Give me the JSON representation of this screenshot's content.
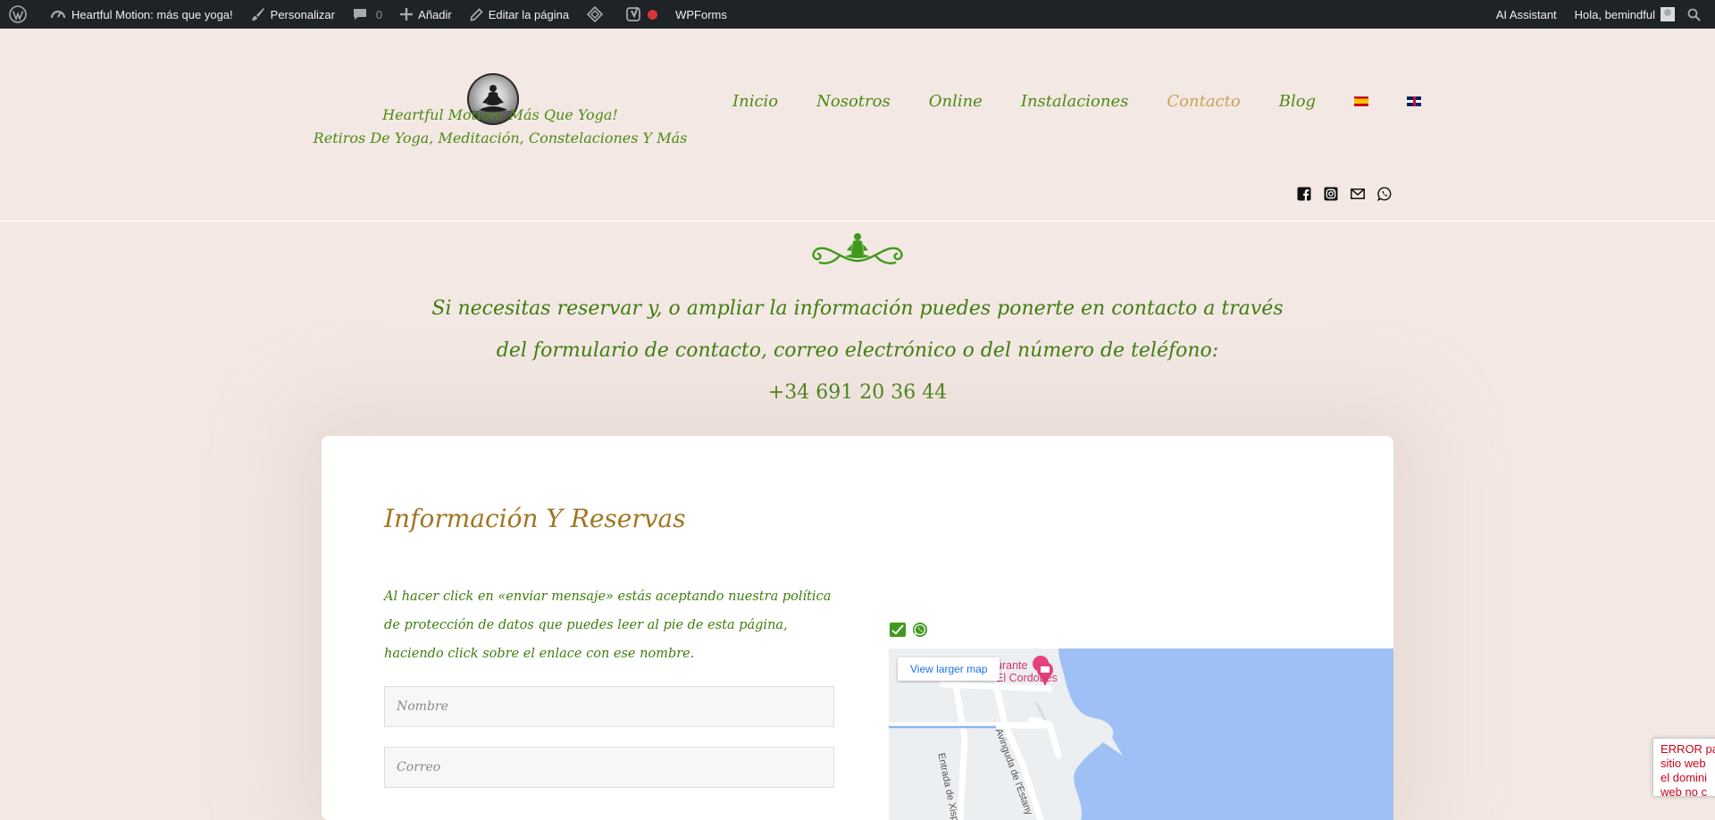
{
  "admin_bar": {
    "site_name": "Heartful Motion: más que yoga!",
    "customize": "Personalizar",
    "comments_count": "0",
    "add_new": "Añadir",
    "edit_page": "Editar la página",
    "wpforms": "WPForms",
    "ai_assistant": "AI Assistant",
    "greeting": "Hola, bemindful"
  },
  "header": {
    "site_title": "Heartful Motion: Más Que Yoga!",
    "tagline": "Retiros De Yoga, Meditación, Constelaciones Y Más"
  },
  "nav": {
    "items": [
      {
        "label": "Inicio"
      },
      {
        "label": "Nosotros"
      },
      {
        "label": "Online"
      },
      {
        "label": "Instalaciones"
      },
      {
        "label": "Contacto",
        "active": true
      },
      {
        "label": "Blog"
      }
    ],
    "languages": [
      "es",
      "en"
    ]
  },
  "social_icons": [
    "facebook-icon",
    "instagram-icon",
    "email-icon",
    "whatsapp-icon"
  ],
  "intro": {
    "line1": "Si necesitas reservar y, o ampliar la información puedes ponerte en contacto a través",
    "line2": "del formulario de contacto, correo electrónico o del número de teléfono:",
    "phone": "+34 691 20 36 44"
  },
  "form": {
    "title": "Información Y Reservas",
    "consent": "Al hacer click en «enviar mensaje» estás aceptando nuestra política de protección de datos que puedes leer al pie de esta página, haciendo click sobre el enlace con ese nombre.",
    "name_placeholder": "Nombre",
    "email_placeholder": "Correo"
  },
  "map": {
    "button": "View larger map",
    "poi_line1": "urante",
    "poi_line2": "El Cordobés",
    "street1": "Entrada de Xispa",
    "street2": "Avinguda de l'Estany"
  },
  "recaptcha_error": "ERROR pa\nsitio web\nel domini\nweb no c",
  "colors": {
    "admin_bar_bg": "#1d2327",
    "page_bg": "#f3e8e3",
    "brand_green": "#4d8a16",
    "heading_gold": "#a37520",
    "nav_active": "#c9a25a",
    "water": "#9fc0f5"
  }
}
